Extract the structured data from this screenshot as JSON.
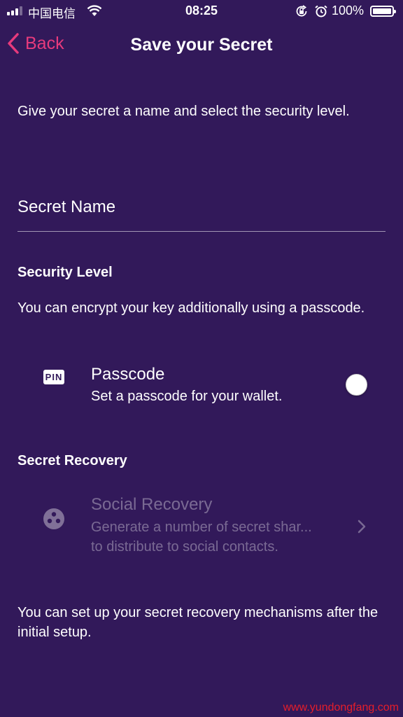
{
  "status_bar": {
    "carrier": "中国电信",
    "time": "08:25",
    "battery": "100%"
  },
  "nav": {
    "back_label": "Back",
    "title": "Save your Secret"
  },
  "intro": "Give your secret a name and select the security level.",
  "secret_name": {
    "placeholder": "Secret Name",
    "value": ""
  },
  "security": {
    "heading": "Security Level",
    "description": "You can encrypt your key additionally using a passcode.",
    "passcode": {
      "icon": "pin-icon",
      "icon_text": "PIN",
      "title": "Passcode",
      "subtitle": "Set a passcode for your wallet.",
      "enabled": false
    }
  },
  "recovery": {
    "heading": "Secret Recovery",
    "social": {
      "icon": "social-recovery-icon",
      "title": "Social Recovery",
      "subtitle_line1": "Generate a number of secret shar...",
      "subtitle_line2": "to distribute to social contacts.",
      "disabled": true
    }
  },
  "footer": "You can set up your secret recovery mechanisms after the initial setup.",
  "watermark": "www.yundongfang.com",
  "colors": {
    "background": "#32195a",
    "accent": "#e73a7c",
    "text": "#ffffff",
    "watermark": "#e61e2a"
  }
}
